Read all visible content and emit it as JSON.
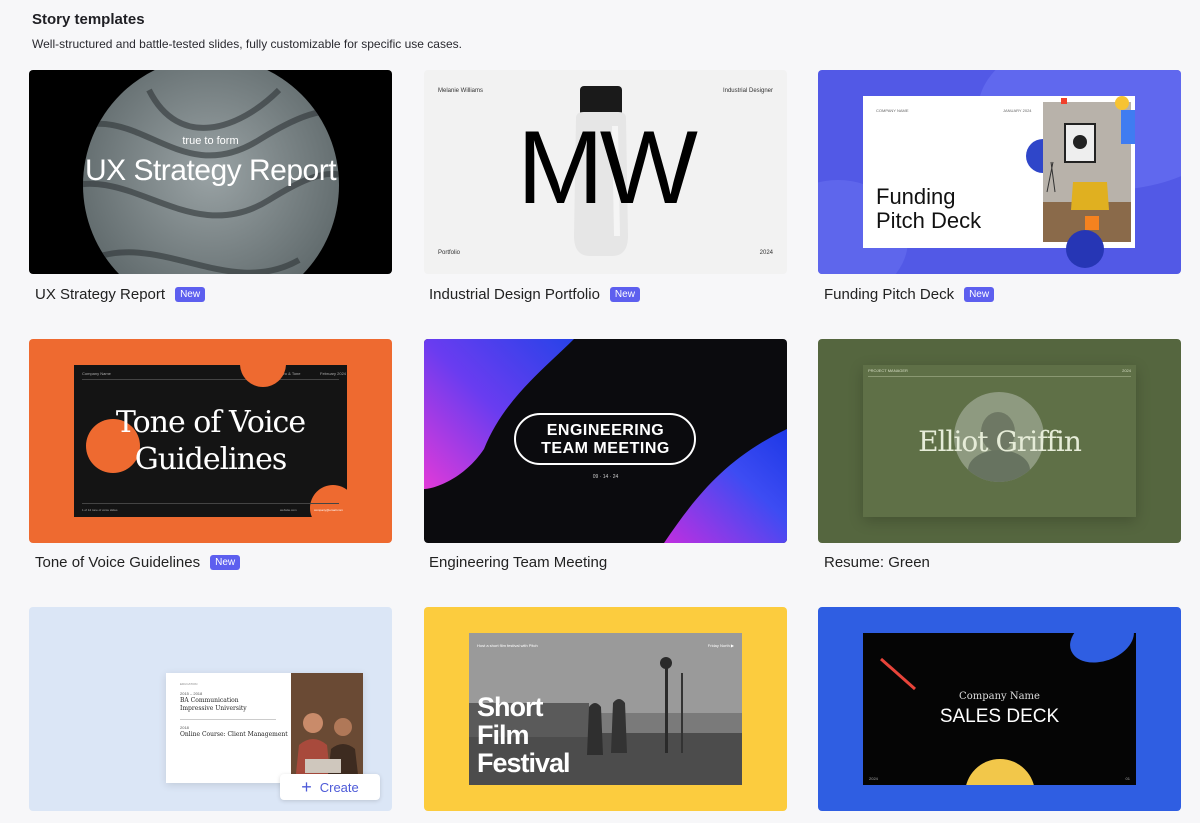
{
  "header": {
    "title": "Story templates",
    "subtitle": "Well-structured and battle-tested slides, fully customizable for specific use cases."
  },
  "badge_text": "New",
  "cards": {
    "ux": {
      "label": "UX Strategy Report",
      "new": true,
      "kicker": "true to form",
      "title": "UX Strategy Report"
    },
    "industrial": {
      "label": "Industrial Design Portfolio",
      "new": true,
      "name": "Melanie Williams",
      "role": "Industrial Designer",
      "monogram": "MW",
      "footer_left": "Portfolio",
      "footer_right": "2024"
    },
    "funding": {
      "label": "Funding Pitch Deck",
      "new": true,
      "company": "COMPANY NAME",
      "date": "JANUARY 2024",
      "title_line1": "Funding",
      "title_line2": "Pitch Deck"
    },
    "tone": {
      "label": "Tone of Voice Guidelines",
      "new": true,
      "top_left": "Company Name",
      "top_mid": "Intro & Tone",
      "top_right": "February 2024",
      "title_line1": "Tone of Voice",
      "title_line2": "Guidelines",
      "foot_left": "1 of 12 tone of voice slides",
      "foot_mid": "website.com",
      "foot_right": "company@email.com"
    },
    "engineering": {
      "label": "Engineering Team Meeting",
      "title_line1": "ENGINEERING",
      "title_line2": "TEAM MEETING",
      "date": "09 · 14 · 24"
    },
    "resume": {
      "label": "Resume: Green",
      "top_left": "PROJECT MANAGER",
      "top_right": "2024",
      "name": "Elliot Griffin"
    },
    "education": {
      "year1": "2015 – 2018",
      "degree": "BA Communication",
      "school": "Impressive University",
      "year2": "2018",
      "course": "Online Course: Client Management",
      "section_label": "EDUCATION",
      "create_label": "Create"
    },
    "film": {
      "top_left": "Host a short film festival with Pitch",
      "top_right": "Friday North ▶",
      "title_line1": "Short",
      "title_line2": "Film",
      "title_line3": "Festival"
    },
    "sales": {
      "company": "Company Name",
      "title": "SALES DECK",
      "foot_left": "2024",
      "foot_right": "01"
    }
  },
  "colors": {
    "accent": "#5d5fef",
    "orange": "#ee6a30",
    "green_bg": "#55663f",
    "funding_bg": "#5259e6",
    "yellow": "#fccc3e",
    "sales_bg": "#2f5ee2"
  }
}
